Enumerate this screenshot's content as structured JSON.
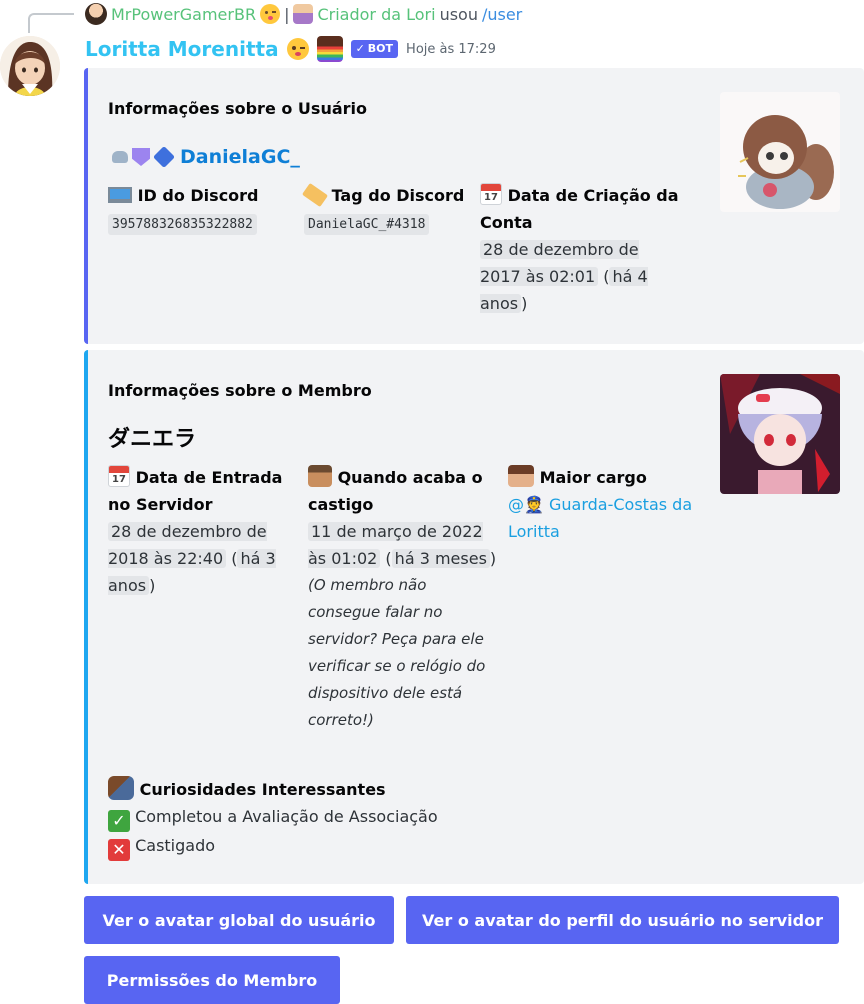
{
  "reply": {
    "author": "MrPowerGamerBR",
    "separator": "|",
    "role": "Criador da Lori",
    "used": "usou",
    "command": "/user"
  },
  "message": {
    "author": "Loritta Morenitta",
    "bot_badge": "BOT",
    "timestamp": "Hoje às 17:29"
  },
  "user_embed": {
    "title": "Informações sobre o Usuário",
    "username": "DanielaGC_",
    "badges": [
      "nitro-badge-icon",
      "hypesquad-badge-icon",
      "active-developer-icon"
    ],
    "fields": [
      {
        "name": "ID do Discord",
        "icon": "laptop-icon",
        "value": "395788326835322882"
      },
      {
        "name": "Tag do Discord",
        "icon": "label-tag-icon",
        "value": "DanielaGC_#4318"
      },
      {
        "name": "Data de Criação da Conta",
        "icon": "calendar-icon",
        "date": "28 de dezembro de 2017 às 02:01",
        "relative": "há 4 anos"
      }
    ],
    "accent": "#5865f2"
  },
  "member_embed": {
    "title": "Informações sobre o Membro",
    "nickname": "ダニエラ",
    "fields": [
      {
        "name": "Data de Entrada no Servidor",
        "icon": "calendar-icon",
        "date": "28 de dezembro de 2018 às 22:40",
        "relative": "há 3 anos"
      },
      {
        "name": "Quando acaba o castigo",
        "icon": "mute-emoji-icon",
        "date": "11 de março de 2022 às 01:02",
        "relative": "há 3 meses",
        "note": "(O membro não consegue falar no servidor? Peça para ele verificar se o relógio do dispositivo dele está correto!)"
      },
      {
        "name": "Maior cargo",
        "icon": "role-emoji-icon",
        "value": "@👮 Guarda-Costas da Loritta"
      }
    ],
    "curiosities_title": "Curiosidades Interessantes",
    "curiosities": [
      {
        "icon": "check-icon",
        "text": "Completou a Avaliação de Associação"
      },
      {
        "icon": "cross-icon",
        "text": "Castigado"
      }
    ],
    "accent": "#1ea7f0"
  },
  "calendar_label": "17",
  "buttons": {
    "global_avatar": "Ver o avatar global do usuário",
    "server_avatar": "Ver o avatar do perfil do usuário no servidor",
    "permissions": "Permissões do Membro"
  }
}
